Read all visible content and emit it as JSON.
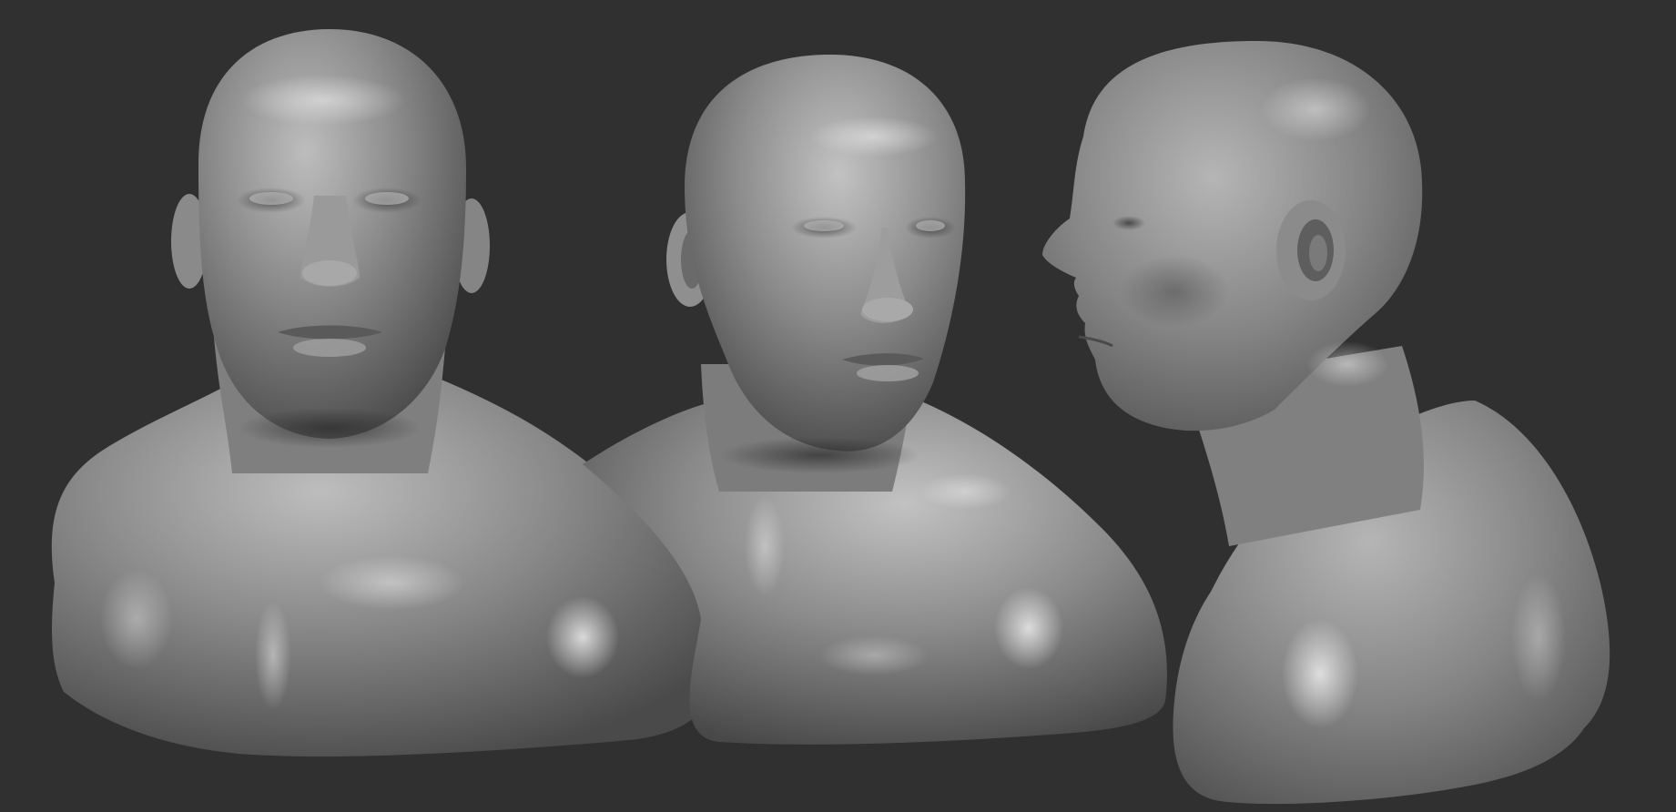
{
  "scene": {
    "background_color": "#303030",
    "material_color": "#8a8a8a",
    "highlight_color": "#d9d9d9",
    "shadow_color": "#3a3a3a",
    "views": [
      {
        "name": "front-view"
      },
      {
        "name": "three-quarter-view"
      },
      {
        "name": "side-profile-view"
      }
    ]
  }
}
